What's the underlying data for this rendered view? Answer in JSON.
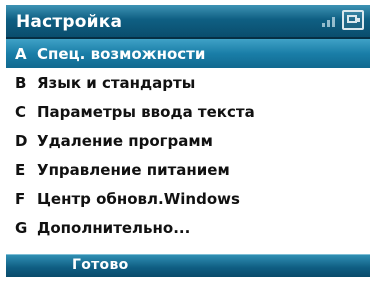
{
  "title": "Настройка",
  "icons": {
    "signal": "signal-icon",
    "battery": "battery-icon"
  },
  "menu": {
    "items": [
      {
        "key": "A",
        "label": "Спец. возможности",
        "selected": true
      },
      {
        "key": "B",
        "label": "Язык и стандарты"
      },
      {
        "key": "C",
        "label": "Параметры ввода текста"
      },
      {
        "key": "D",
        "label": "Удаление программ"
      },
      {
        "key": "E",
        "label": "Управление питанием"
      },
      {
        "key": "F",
        "label": "Центр обновл.Windows"
      },
      {
        "key": "G",
        "label": "Дополнительно..."
      }
    ]
  },
  "softkeys": {
    "left": "Готово"
  },
  "colors": {
    "title_bar": "#0f5f83",
    "selection": "#1a7ea8",
    "text": "#111111"
  }
}
